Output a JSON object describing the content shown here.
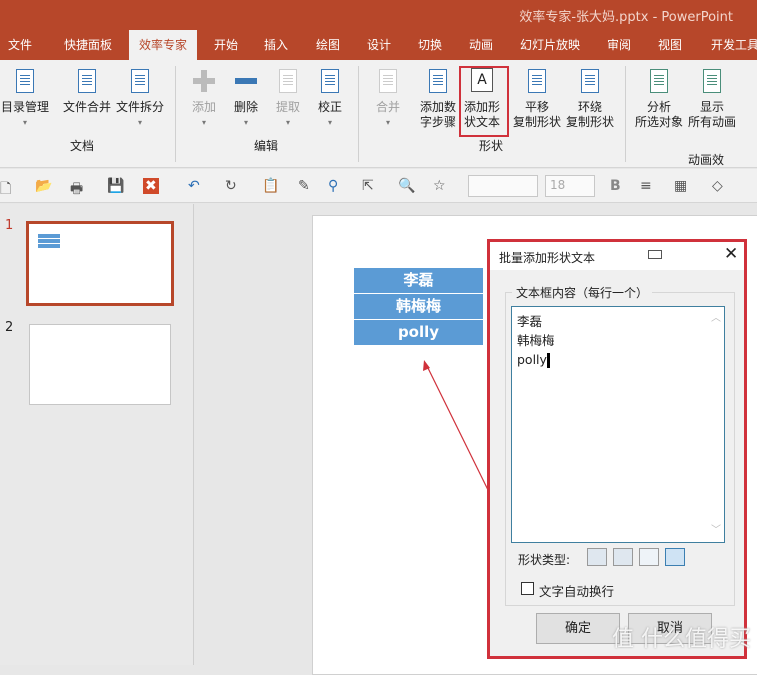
{
  "window": {
    "title": "效率专家-张大妈.pptx  -  PowerPoint"
  },
  "tabs": [
    {
      "label": "文件"
    },
    {
      "label": "快捷面板"
    },
    {
      "label": "效率专家",
      "active": true
    },
    {
      "label": "开始"
    },
    {
      "label": "插入"
    },
    {
      "label": "绘图"
    },
    {
      "label": "设计"
    },
    {
      "label": "切换"
    },
    {
      "label": "动画"
    },
    {
      "label": "幻灯片放映"
    },
    {
      "label": "审阅"
    },
    {
      "label": "视图"
    },
    {
      "label": "开发工具"
    }
  ],
  "ribbon": {
    "buttons": [
      {
        "label": "目录管理",
        "icon": "toc-icon",
        "dropdown": true
      },
      {
        "label": "文件合并",
        "icon": "merge-files-icon"
      },
      {
        "label": "文件拆分",
        "icon": "split-files-icon",
        "dropdown": true
      },
      {
        "label": "添加",
        "icon": "plus-icon",
        "dropdown": true,
        "disabled": true
      },
      {
        "label": "删除",
        "icon": "minus-icon",
        "dropdown": true
      },
      {
        "label": "提取",
        "icon": "extract-icon",
        "dropdown": true,
        "disabled": true
      },
      {
        "label": "校正",
        "icon": "correct-icon",
        "dropdown": true
      },
      {
        "label": "合并",
        "icon": "combine-icon",
        "dropdown": true,
        "disabled": true
      },
      {
        "label": "添加数\n字步骤",
        "icon": "number-steps-icon"
      },
      {
        "label": "添加形\n状文本",
        "icon": "shape-text-icon",
        "highlighted": true
      },
      {
        "label": "平移\n复制形状",
        "icon": "translate-copy-icon"
      },
      {
        "label": "环绕\n复制形状",
        "icon": "circular-copy-icon"
      },
      {
        "label": "分析\n所选对象",
        "icon": "analyze-icon"
      },
      {
        "label": "显示\n所有动画",
        "icon": "show-animations-icon"
      }
    ],
    "groups": [
      "文档",
      "编辑",
      "形状",
      "动画效果"
    ]
  },
  "quick_toolbar": {
    "font_size": "18",
    "icons": [
      "new-icon",
      "open-icon",
      "print-icon",
      "save-icon",
      "close-icon",
      "undo-icon",
      "redo-icon",
      "paste-icon",
      "brush-icon",
      "find-icon",
      "select-icon",
      "zoom-icon",
      "star-icon",
      "bold-icon",
      "align-icon",
      "table-icon",
      "fill-icon"
    ],
    "bold_label": "B"
  },
  "slides": [
    {
      "number": "1",
      "selected": true
    },
    {
      "number": "2"
    }
  ],
  "slide_shapes": [
    "李磊",
    "韩梅梅",
    "polly"
  ],
  "dialog": {
    "title": "批量添加形状文本",
    "group_label": "文本框内容（每行一个）",
    "lines": [
      "李磊",
      "韩梅梅",
      "polly"
    ],
    "shape_type_label": "形状类型:",
    "wrap_label": "文字自动换行",
    "wrap_checked": false,
    "ok": "确定",
    "cancel": "取消"
  },
  "watermark": "值 什么值得买",
  "colors": {
    "brand": "#b7472a",
    "highlight": "#d0313b",
    "shape": "#5b9bd5"
  }
}
